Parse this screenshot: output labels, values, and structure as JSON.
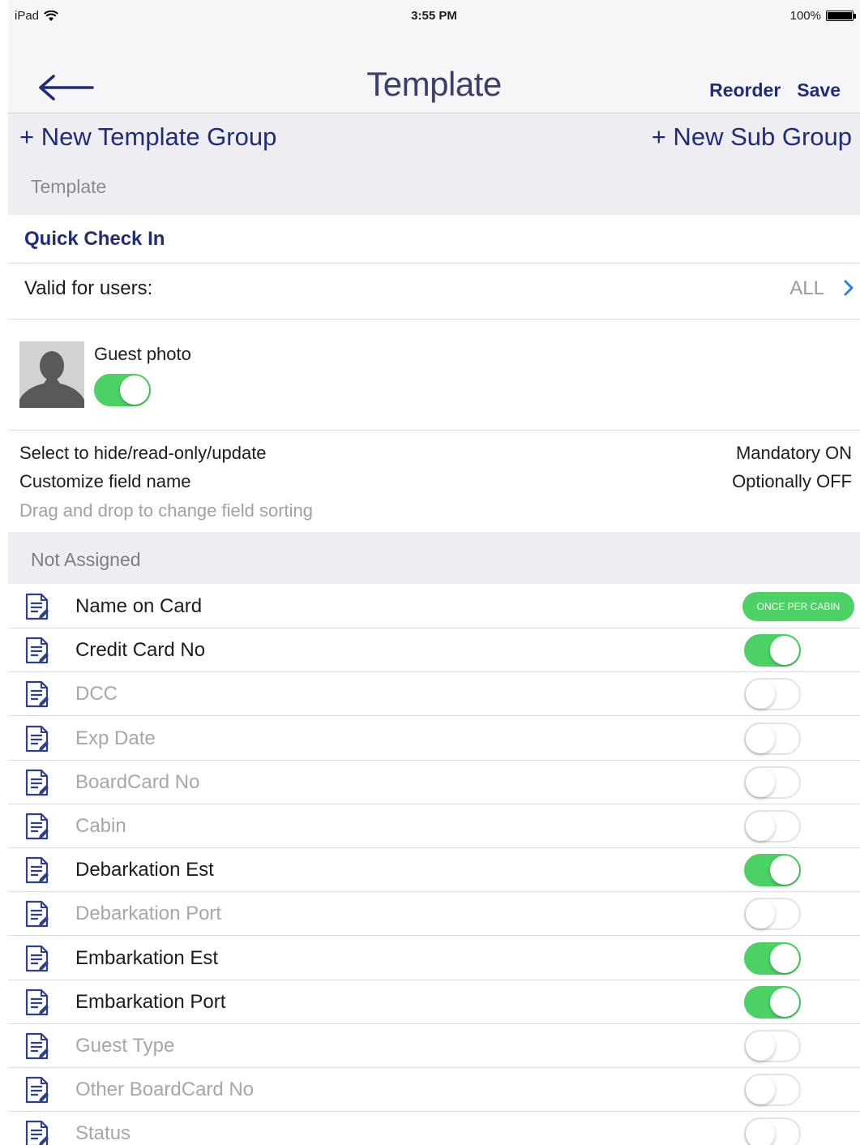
{
  "statusbar": {
    "device": "iPad",
    "time": "3:55 PM",
    "battery": "100%"
  },
  "navbar": {
    "title": "Template",
    "reorder_label": "Reorder",
    "save_label": "Save"
  },
  "groupbar": {
    "new_template_group": "+ New Template Group",
    "new_sub_group": "+ New Sub Group",
    "section_label": "Template"
  },
  "template": {
    "name": "Quick Check In",
    "valid_users_label": "Valid for users:",
    "valid_users_value": "ALL"
  },
  "guest_photo": {
    "label": "Guest photo",
    "enabled": true
  },
  "info": {
    "line1_left": "Select to hide/read-only/update",
    "line1_right": "Mandatory ON",
    "line2_left": "Customize field name",
    "line2_right": "Optionally OFF",
    "line3": "Drag and drop to change field sorting"
  },
  "section": {
    "title": "Not Assigned"
  },
  "fields": [
    {
      "label": "Name on Card",
      "state": "pill",
      "pill_label": "ONCE PER CABIN"
    },
    {
      "label": "Credit Card No",
      "state": "on"
    },
    {
      "label": "DCC",
      "state": "off"
    },
    {
      "label": "Exp Date",
      "state": "off"
    },
    {
      "label": "BoardCard No",
      "state": "off"
    },
    {
      "label": "Cabin",
      "state": "off"
    },
    {
      "label": "Debarkation Est",
      "state": "on"
    },
    {
      "label": "Debarkation Port",
      "state": "off"
    },
    {
      "label": "Embarkation Est",
      "state": "on"
    },
    {
      "label": "Embarkation Port",
      "state": "on"
    },
    {
      "label": "Guest Type",
      "state": "off"
    },
    {
      "label": "Other BoardCard No",
      "state": "off"
    },
    {
      "label": "Status",
      "state": "off"
    }
  ],
  "colors": {
    "accent": "#1f2c7a",
    "toggle_on": "#4cd264",
    "link_chevron": "#2b7de9"
  }
}
